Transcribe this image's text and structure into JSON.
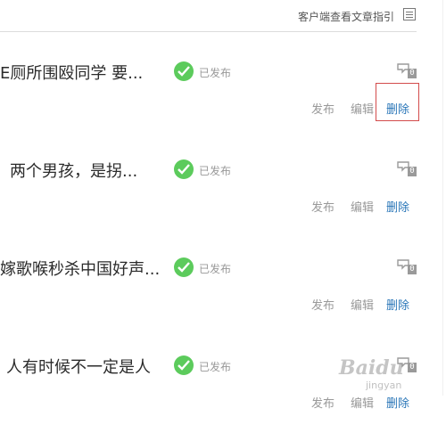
{
  "header": {
    "guide_text": "客户端查看文章指引",
    "guide_icon": "document-list-icon"
  },
  "articles": [
    {
      "title": "E厕所围殴同学 要...",
      "status": "已发布",
      "comment_count": "0",
      "actions": {
        "publish": "发布",
        "edit": "编辑",
        "delete": "删除"
      }
    },
    {
      "title": "两个男孩，是拐...",
      "status": "已发布",
      "comment_count": "0",
      "actions": {
        "publish": "发布",
        "edit": "编辑",
        "delete": "删除"
      }
    },
    {
      "title": "嫁歌喉秒杀中国好声...",
      "status": "已发布",
      "comment_count": "0",
      "actions": {
        "publish": "发布",
        "edit": "编辑",
        "delete": "删除"
      }
    },
    {
      "title": "人有时候不一定是人",
      "status": "已发布",
      "comment_count": "0",
      "actions": {
        "publish": "发布",
        "edit": "编辑",
        "delete": "删除"
      }
    }
  ],
  "watermark": {
    "text": "Baidu",
    "sub": "jingyan"
  },
  "colors": {
    "status_green": "#5ccb5c",
    "delete_link": "#2a76b8",
    "highlight_red": "#d34b4b"
  }
}
